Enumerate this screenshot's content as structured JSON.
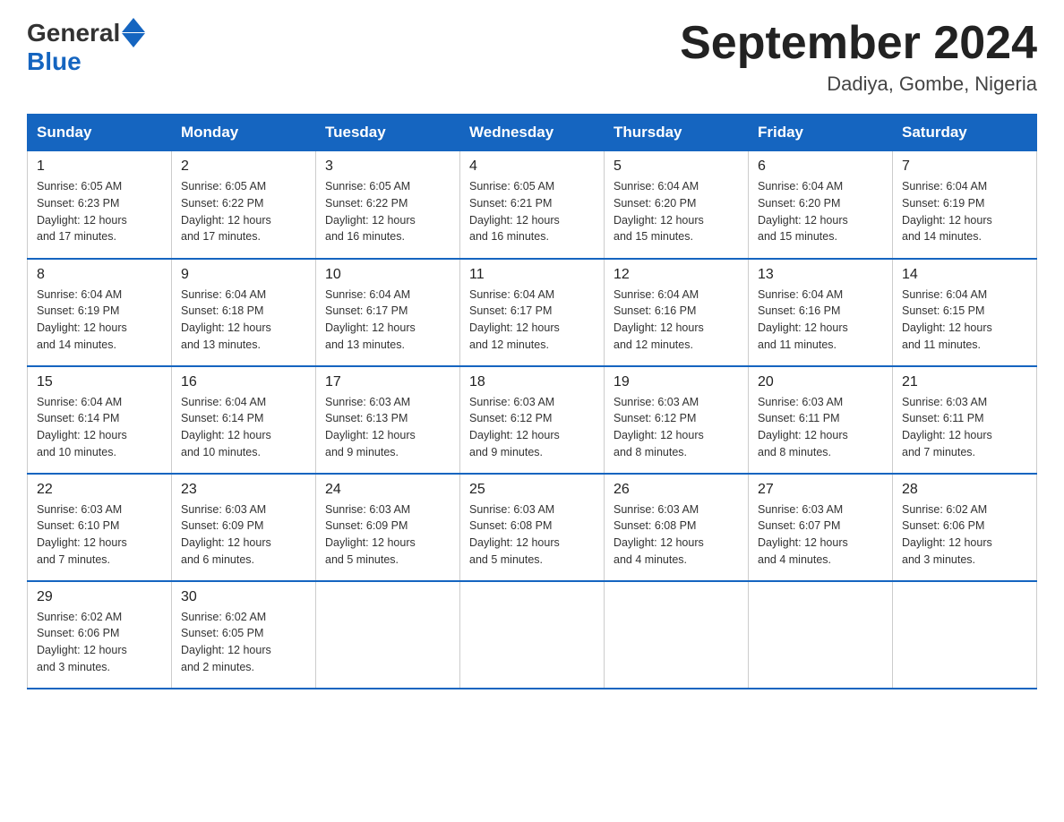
{
  "header": {
    "logo_general": "General",
    "logo_blue": "Blue",
    "title": "September 2024",
    "subtitle": "Dadiya, Gombe, Nigeria"
  },
  "weekdays": [
    "Sunday",
    "Monday",
    "Tuesday",
    "Wednesday",
    "Thursday",
    "Friday",
    "Saturday"
  ],
  "weeks": [
    [
      {
        "day": "1",
        "sunrise": "6:05 AM",
        "sunset": "6:23 PM",
        "daylight": "12 hours and 17 minutes."
      },
      {
        "day": "2",
        "sunrise": "6:05 AM",
        "sunset": "6:22 PM",
        "daylight": "12 hours and 17 minutes."
      },
      {
        "day": "3",
        "sunrise": "6:05 AM",
        "sunset": "6:22 PM",
        "daylight": "12 hours and 16 minutes."
      },
      {
        "day": "4",
        "sunrise": "6:05 AM",
        "sunset": "6:21 PM",
        "daylight": "12 hours and 16 minutes."
      },
      {
        "day": "5",
        "sunrise": "6:04 AM",
        "sunset": "6:20 PM",
        "daylight": "12 hours and 15 minutes."
      },
      {
        "day": "6",
        "sunrise": "6:04 AM",
        "sunset": "6:20 PM",
        "daylight": "12 hours and 15 minutes."
      },
      {
        "day": "7",
        "sunrise": "6:04 AM",
        "sunset": "6:19 PM",
        "daylight": "12 hours and 14 minutes."
      }
    ],
    [
      {
        "day": "8",
        "sunrise": "6:04 AM",
        "sunset": "6:19 PM",
        "daylight": "12 hours and 14 minutes."
      },
      {
        "day": "9",
        "sunrise": "6:04 AM",
        "sunset": "6:18 PM",
        "daylight": "12 hours and 13 minutes."
      },
      {
        "day": "10",
        "sunrise": "6:04 AM",
        "sunset": "6:17 PM",
        "daylight": "12 hours and 13 minutes."
      },
      {
        "day": "11",
        "sunrise": "6:04 AM",
        "sunset": "6:17 PM",
        "daylight": "12 hours and 12 minutes."
      },
      {
        "day": "12",
        "sunrise": "6:04 AM",
        "sunset": "6:16 PM",
        "daylight": "12 hours and 12 minutes."
      },
      {
        "day": "13",
        "sunrise": "6:04 AM",
        "sunset": "6:16 PM",
        "daylight": "12 hours and 11 minutes."
      },
      {
        "day": "14",
        "sunrise": "6:04 AM",
        "sunset": "6:15 PM",
        "daylight": "12 hours and 11 minutes."
      }
    ],
    [
      {
        "day": "15",
        "sunrise": "6:04 AM",
        "sunset": "6:14 PM",
        "daylight": "12 hours and 10 minutes."
      },
      {
        "day": "16",
        "sunrise": "6:04 AM",
        "sunset": "6:14 PM",
        "daylight": "12 hours and 10 minutes."
      },
      {
        "day": "17",
        "sunrise": "6:03 AM",
        "sunset": "6:13 PM",
        "daylight": "12 hours and 9 minutes."
      },
      {
        "day": "18",
        "sunrise": "6:03 AM",
        "sunset": "6:12 PM",
        "daylight": "12 hours and 9 minutes."
      },
      {
        "day": "19",
        "sunrise": "6:03 AM",
        "sunset": "6:12 PM",
        "daylight": "12 hours and 8 minutes."
      },
      {
        "day": "20",
        "sunrise": "6:03 AM",
        "sunset": "6:11 PM",
        "daylight": "12 hours and 8 minutes."
      },
      {
        "day": "21",
        "sunrise": "6:03 AM",
        "sunset": "6:11 PM",
        "daylight": "12 hours and 7 minutes."
      }
    ],
    [
      {
        "day": "22",
        "sunrise": "6:03 AM",
        "sunset": "6:10 PM",
        "daylight": "12 hours and 7 minutes."
      },
      {
        "day": "23",
        "sunrise": "6:03 AM",
        "sunset": "6:09 PM",
        "daylight": "12 hours and 6 minutes."
      },
      {
        "day": "24",
        "sunrise": "6:03 AM",
        "sunset": "6:09 PM",
        "daylight": "12 hours and 5 minutes."
      },
      {
        "day": "25",
        "sunrise": "6:03 AM",
        "sunset": "6:08 PM",
        "daylight": "12 hours and 5 minutes."
      },
      {
        "day": "26",
        "sunrise": "6:03 AM",
        "sunset": "6:08 PM",
        "daylight": "12 hours and 4 minutes."
      },
      {
        "day": "27",
        "sunrise": "6:03 AM",
        "sunset": "6:07 PM",
        "daylight": "12 hours and 4 minutes."
      },
      {
        "day": "28",
        "sunrise": "6:02 AM",
        "sunset": "6:06 PM",
        "daylight": "12 hours and 3 minutes."
      }
    ],
    [
      {
        "day": "29",
        "sunrise": "6:02 AM",
        "sunset": "6:06 PM",
        "daylight": "12 hours and 3 minutes."
      },
      {
        "day": "30",
        "sunrise": "6:02 AM",
        "sunset": "6:05 PM",
        "daylight": "12 hours and 2 minutes."
      },
      null,
      null,
      null,
      null,
      null
    ]
  ],
  "labels": {
    "sunrise": "Sunrise:",
    "sunset": "Sunset:",
    "daylight": "Daylight:"
  }
}
